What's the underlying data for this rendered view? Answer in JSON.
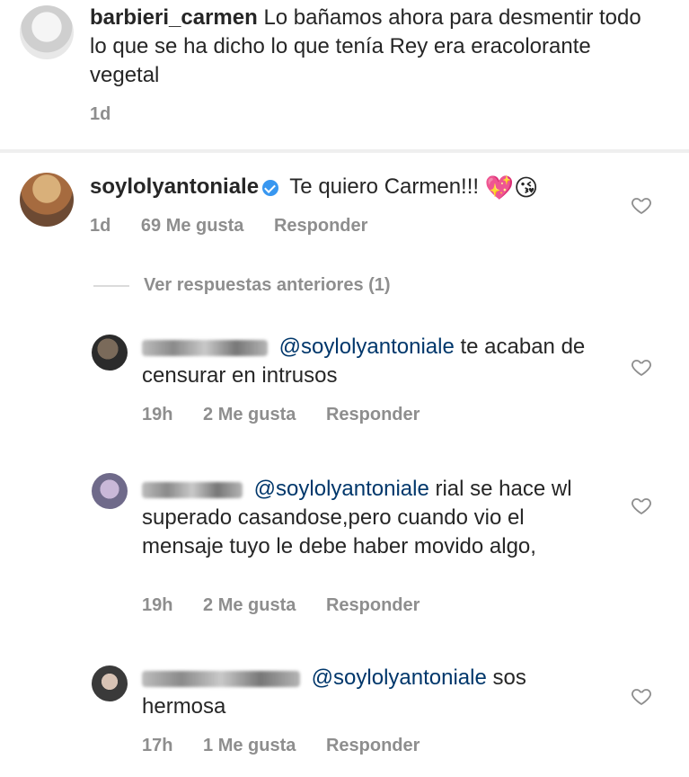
{
  "comments": [
    {
      "username": "barbieri_carmen",
      "text": "Lo bañamos ahora para desmentir todo lo que se ha dicho lo que tenía Rey era  eracolorante vegetal",
      "time": "1d"
    },
    {
      "username": "soylolyantoniale",
      "text": "Te quiero Carmen!!!",
      "emojis": "💖😘",
      "time": "1d",
      "likes": "69 Me gusta",
      "reply": "Responder"
    }
  ],
  "view_more": "Ver respuestas anteriores (1)",
  "replies": [
    {
      "mention": "@soylolyantoniale",
      "text": "te acaban de censurar en intrusos",
      "time": "19h",
      "likes": "2 Me gusta",
      "reply": "Responder"
    },
    {
      "mention": "@soylolyantoniale",
      "text": "rial se hace wl superado casandose,pero cuando vio el mensaje tuyo le debe haber movido algo,",
      "time": "19h",
      "likes": "2 Me gusta",
      "reply": "Responder"
    },
    {
      "mention": "@soylolyantoniale",
      "text": "sos hermosa",
      "time": "17h",
      "likes": "1 Me gusta",
      "reply": "Responder"
    }
  ],
  "icons": {
    "like": "heart-outline-icon",
    "verified": "verified-badge-icon"
  }
}
